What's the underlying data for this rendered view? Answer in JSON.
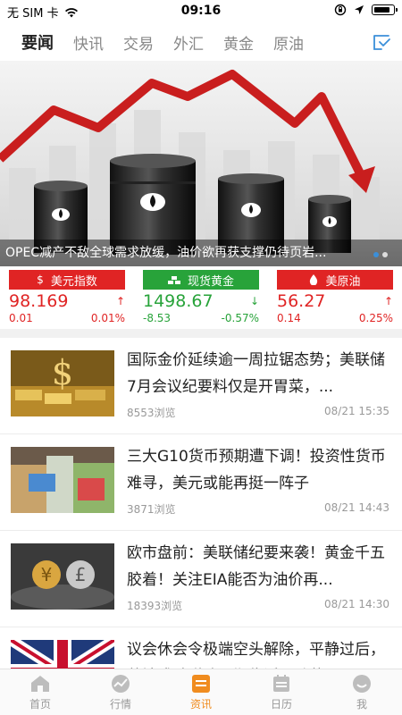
{
  "status_bar": {
    "carrier": "无 SIM 卡",
    "time": "09:16"
  },
  "tabs": [
    {
      "label": "要闻",
      "active": true
    },
    {
      "label": "快讯",
      "active": false
    },
    {
      "label": "交易",
      "active": false
    },
    {
      "label": "外汇",
      "active": false
    },
    {
      "label": "黄金",
      "active": false
    },
    {
      "label": "原油",
      "active": false
    }
  ],
  "banner": {
    "caption": "OPEC减产不敌全球需求放缓，油价欲再获支撑仍待页岩...",
    "slide_count": 2,
    "active_slide": 0
  },
  "quotes": [
    {
      "label": "美元指数",
      "icon": "dollar-icon",
      "value": "98.169",
      "change": "0.01",
      "percent": "0.01%",
      "trend": "up"
    },
    {
      "label": "现货黄金",
      "icon": "gold-bars-icon",
      "value": "1498.67",
      "change": "-8.53",
      "percent": "-0.57%",
      "trend": "down"
    },
    {
      "label": "美原油",
      "icon": "oil-drop-icon",
      "value": "56.27",
      "change": "0.14",
      "percent": "0.25%",
      "trend": "up"
    }
  ],
  "news": [
    {
      "title": "国际金价延续逾一周拉锯态势；美联储7月会议纪要料仅是开胃菜，...",
      "views": "8553浏览",
      "date": "08/21 15:35",
      "thumb": "gold-dollar-sign"
    },
    {
      "title": "三大G10货币预期遭下调！投资性货币难寻，美元或能再挺一阵子",
      "views": "3871浏览",
      "date": "08/21 14:43",
      "thumb": "banknotes"
    },
    {
      "title": "欧市盘前：美联储纪要来袭！黄金千五胶着！关注EIA能否为油价再...",
      "views": "18393浏览",
      "date": "08/21 14:30",
      "thumb": "currency-coins"
    },
    {
      "title": "议会休会令极端空头解除，平静过后，英镑或随脱欧日期临近再动荡",
      "views": "",
      "date": "",
      "thumb": "uk-flag"
    }
  ],
  "bottom_nav": [
    {
      "label": "首页",
      "icon": "home-icon",
      "active": false
    },
    {
      "label": "行情",
      "icon": "chart-icon",
      "active": false
    },
    {
      "label": "资讯",
      "icon": "news-icon",
      "active": true
    },
    {
      "label": "日历",
      "icon": "calendar-icon",
      "active": false
    },
    {
      "label": "我",
      "icon": "profile-icon",
      "active": false
    }
  ],
  "colors": {
    "red": "#e02424",
    "green": "#28a33a",
    "accent": "#f08c1f",
    "tab_active": "#222222",
    "tab_inactive": "#888888"
  }
}
